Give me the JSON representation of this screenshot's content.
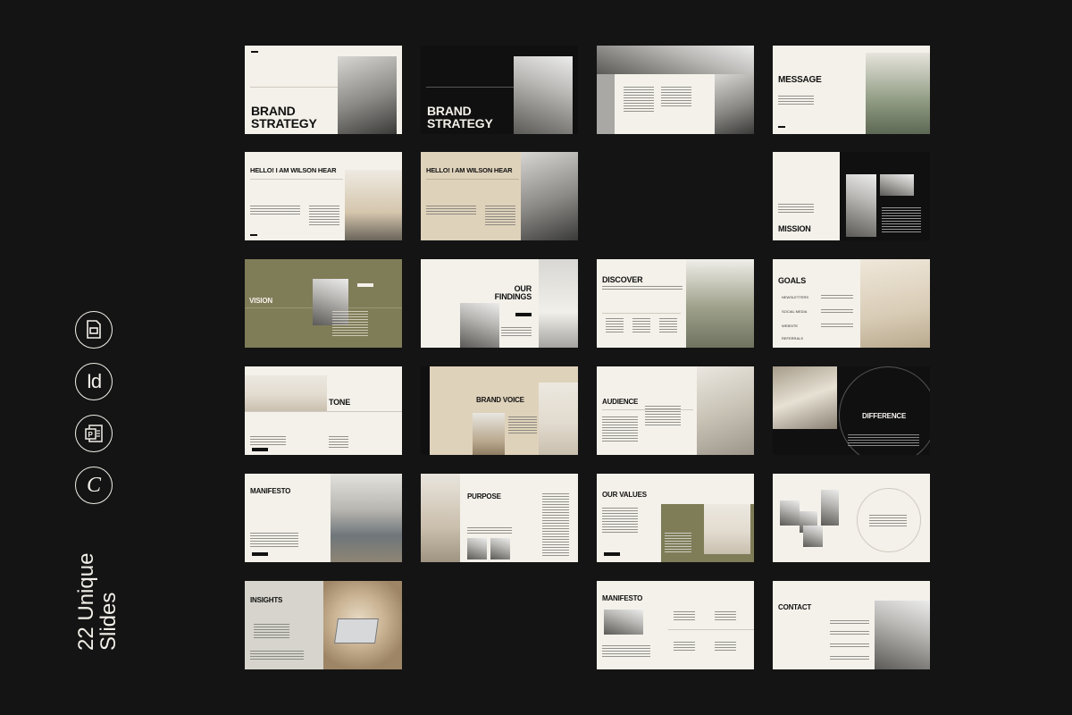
{
  "sidebar": {
    "icons": [
      "google-slides-icon",
      "indesign-icon",
      "powerpoint-icon",
      "canva-icon"
    ],
    "indesign_glyph": "Id",
    "canva_glyph": "C",
    "label_line1": "22 Unique",
    "label_line2": "Slides"
  },
  "slides": {
    "s1": "BRAND STRATEGY",
    "s2": "BRAND STRATEGY",
    "s4": "MESSAGE",
    "s5": "HELLO! I AM WILSON HEAR",
    "s6": "HELLO! I AM WILSON HEAR",
    "s7": "MISSION",
    "s8": "VISION",
    "s9": "OUR FINDINGS",
    "s10": "DISCOVER",
    "s11": "GOALS",
    "s11_items": [
      "NEWSLETTERS",
      "SOCIAL MEDIA",
      "WEBSITE",
      "REFERRALS"
    ],
    "s12": "TONE",
    "s13": "BRAND VOICE",
    "s14": "AUDIENCE",
    "s15": "DIFFERENCE",
    "s16": "MANIFESTO",
    "s17": "PURPOSE",
    "s18": "OUR VALUES",
    "s20": "INSIGHTS",
    "s21": "MANIFESTO",
    "s22": "CONTACT"
  },
  "colors": {
    "background": "#141414",
    "cream": "#f4f1ea",
    "olive": "#7f7c58",
    "tan": "#dfd2bb",
    "ink": "#111111"
  }
}
